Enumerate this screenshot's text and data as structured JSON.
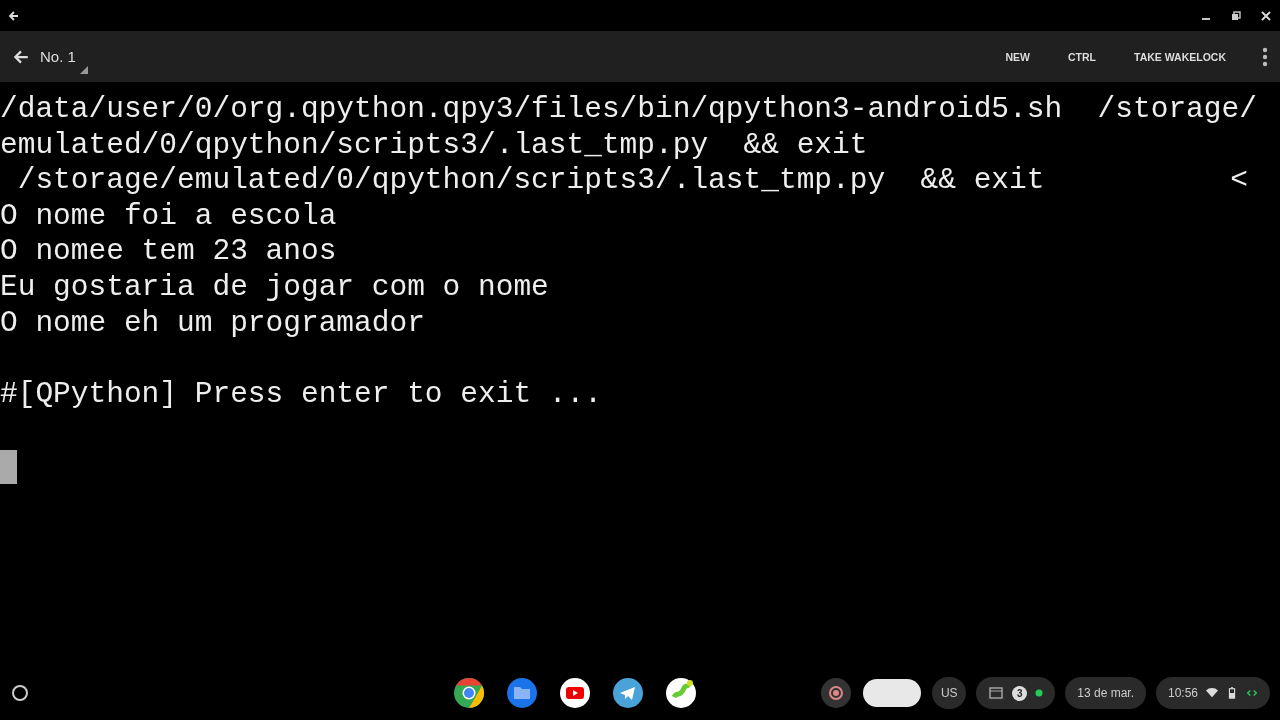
{
  "toolbar": {
    "title": "No. 1",
    "actions": [
      "NEW",
      "CTRL",
      "TAKE WAKELOCK"
    ]
  },
  "terminal": {
    "lines": [
      "/data/user/0/org.qpython.qpy3/files/bin/qpython3-android5.sh  /storage/",
      "emulated/0/qpython/scripts3/.last_tmp.py  && exit",
      " /storage/emulated/0/qpython/scripts3/.last_tmp.py  && exit",
      "O nome foi a escola",
      "O nomee tem 23 anos",
      "Eu gostaria de jogar com o nome",
      "O nome eh um programador"
    ],
    "prompt": "#[QPython] Press enter to exit ...",
    "edge_mark": "<"
  },
  "tray": {
    "keyboard": "US",
    "notification_count": "3",
    "date": "13 de mar.",
    "time": "10:56"
  }
}
